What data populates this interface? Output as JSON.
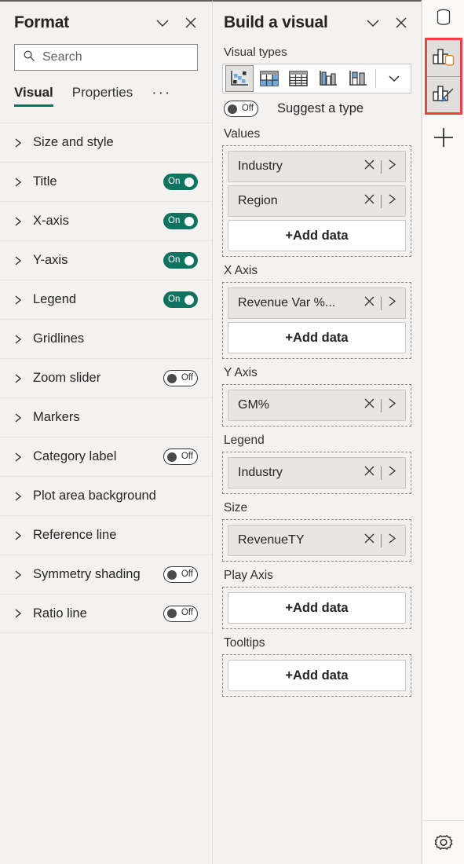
{
  "format_panel": {
    "title": "Format",
    "collapse_icon": "chevron-down-icon",
    "close_icon": "close-icon",
    "search": {
      "value": "",
      "placeholder": "Search",
      "icon": "search-icon"
    },
    "tabs": [
      {
        "label": "Visual",
        "active": true
      },
      {
        "label": "Properties",
        "active": false
      }
    ],
    "more_label": "···",
    "rows": [
      {
        "label": "Size and style",
        "toggle": null
      },
      {
        "label": "Title",
        "toggle": "On"
      },
      {
        "label": "X-axis",
        "toggle": "On"
      },
      {
        "label": "Y-axis",
        "toggle": "On"
      },
      {
        "label": "Legend",
        "toggle": "On"
      },
      {
        "label": "Gridlines",
        "toggle": null
      },
      {
        "label": "Zoom slider",
        "toggle": "Off"
      },
      {
        "label": "Markers",
        "toggle": null
      },
      {
        "label": "Category label",
        "toggle": "Off"
      },
      {
        "label": "Plot area background",
        "toggle": null
      },
      {
        "label": "Reference line",
        "toggle": null
      },
      {
        "label": "Symmetry shading",
        "toggle": "Off"
      },
      {
        "label": "Ratio line",
        "toggle": "Off"
      }
    ]
  },
  "build_panel": {
    "title": "Build a visual",
    "collapse_icon": "chevron-down-icon",
    "close_icon": "close-icon",
    "visual_types_label": "Visual types",
    "visual_types": [
      {
        "name": "scatter-chart-icon",
        "selected": true
      },
      {
        "name": "matrix-table-icon",
        "selected": false
      },
      {
        "name": "table-icon",
        "selected": false
      },
      {
        "name": "clustered-column-chart-icon",
        "selected": false
      },
      {
        "name": "stacked-column-chart-icon",
        "selected": false
      }
    ],
    "visual_types_expand_icon": "chevron-down-icon",
    "suggest": {
      "toggle": "Off",
      "label": "Suggest a type"
    },
    "groups": [
      {
        "title": "Values",
        "fields": [
          "Industry",
          "Region"
        ],
        "add_label": "+Add data"
      },
      {
        "title": "X Axis",
        "fields": [
          "Revenue Var %..."
        ],
        "add_label": "+Add data"
      },
      {
        "title": "Y Axis",
        "fields": [
          "GM%"
        ],
        "add_label": null
      },
      {
        "title": "Legend",
        "fields": [
          "Industry"
        ],
        "add_label": null
      },
      {
        "title": "Size",
        "fields": [
          "RevenueTY"
        ],
        "add_label": null
      },
      {
        "title": "Play Axis",
        "fields": [],
        "add_label": "+Add data"
      },
      {
        "title": "Tooltips",
        "fields": [],
        "add_label": "+Add data"
      }
    ],
    "pill_remove_icon": "close-icon",
    "pill_menu_icon": "chevron-right-icon"
  },
  "rail": {
    "items": [
      {
        "name": "data-cylinder-icon",
        "highlighted": false
      },
      {
        "name": "build-visual-icon",
        "highlighted": true
      },
      {
        "name": "format-visual-icon",
        "highlighted": true
      },
      {
        "name": "add-plus-icon",
        "highlighted": false
      }
    ],
    "settings_icon": "gear-icon",
    "highlight_color": "#f03f3f"
  },
  "colors": {
    "accent_on": "#0f7360",
    "panel_bg": "#f3f2f1",
    "text": "#252423",
    "highlight": "#f03f3f"
  }
}
